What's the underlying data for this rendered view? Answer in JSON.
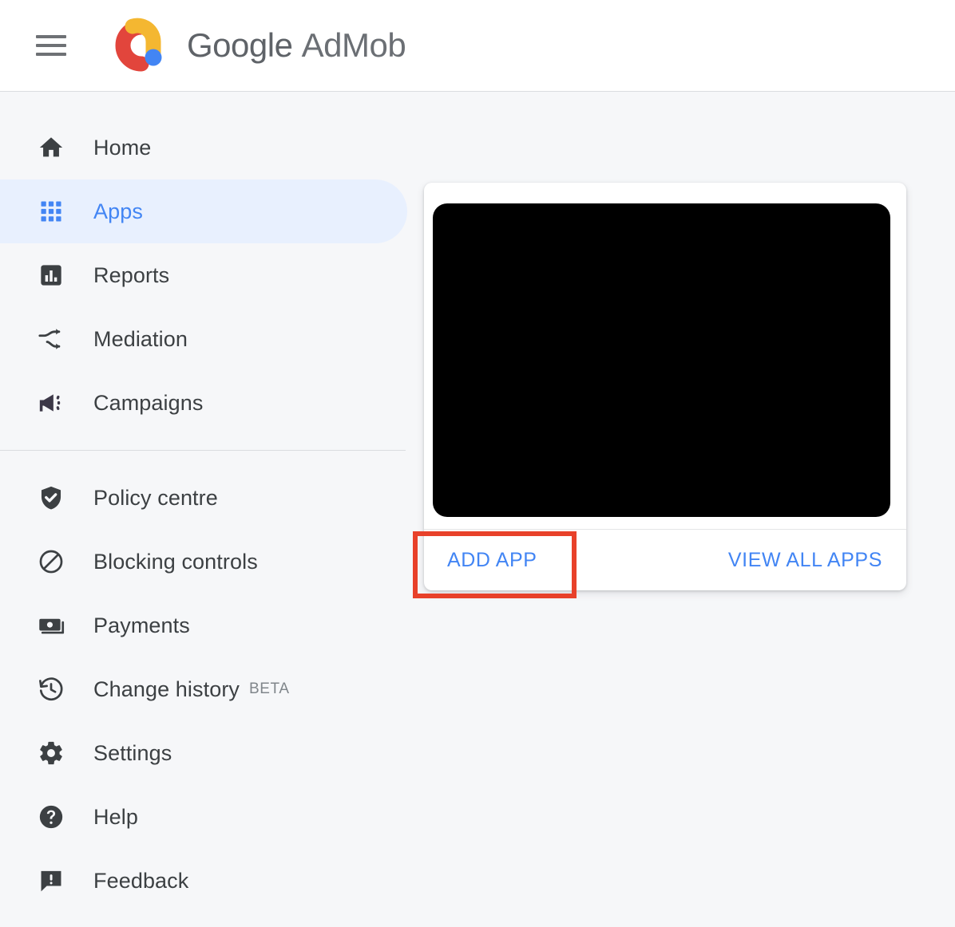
{
  "header": {
    "menu_icon": "hamburger-menu-icon",
    "logo_icon": "admob-logo-icon",
    "brand_google": "Google",
    "brand_product": "AdMob",
    "brand_full": "Google AdMob",
    "logo_colors": {
      "red": "#E2453C",
      "yellow": "#F4B731",
      "blue": "#4285F4"
    }
  },
  "sidebar": {
    "group_primary": [
      {
        "label": "Home",
        "icon": "home-icon",
        "active": false
      },
      {
        "label": "Apps",
        "icon": "apps-grid-icon",
        "active": true
      },
      {
        "label": "Reports",
        "icon": "bar-chart-icon",
        "active": false
      },
      {
        "label": "Mediation",
        "icon": "mediation-arrows-icon",
        "active": false
      },
      {
        "label": "Campaigns",
        "icon": "megaphone-icon",
        "active": false
      }
    ],
    "group_secondary": [
      {
        "label": "Policy centre",
        "icon": "shield-check-icon",
        "badge": ""
      },
      {
        "label": "Blocking controls",
        "icon": "block-circle-icon",
        "badge": ""
      },
      {
        "label": "Payments",
        "icon": "banknotes-icon",
        "badge": ""
      },
      {
        "label": "Change history",
        "icon": "history-clock-icon",
        "badge": "BETA"
      },
      {
        "label": "Settings",
        "icon": "gear-icon",
        "badge": ""
      },
      {
        "label": "Help",
        "icon": "help-circle-icon",
        "badge": ""
      },
      {
        "label": "Feedback",
        "icon": "feedback-icon",
        "badge": ""
      }
    ],
    "active_bg": "#E8F0FE",
    "active_fg": "#4285F4"
  },
  "main": {
    "card": {
      "preview_label": "",
      "preview_color": "#000000",
      "actions": {
        "add_app": "ADD APP",
        "view_all_apps": "VIEW ALL APPS"
      },
      "link_color": "#4285F4"
    },
    "highlight": {
      "target": "ADD APP",
      "color": "#E8412A"
    }
  }
}
